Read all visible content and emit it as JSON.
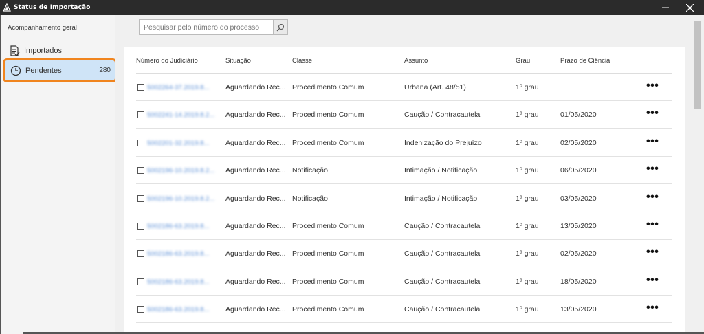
{
  "window": {
    "title": "Status de Importação"
  },
  "sidebar": {
    "overview_label": "Acompanhamento geral",
    "items": [
      {
        "label": "Importados",
        "icon": "document-list-icon"
      },
      {
        "label": "Pendentes",
        "icon": "clock-icon",
        "count": "280",
        "selected": true
      }
    ]
  },
  "search": {
    "placeholder": "Pesquisar pelo número do processo",
    "icon": "search-icon"
  },
  "table": {
    "columns": [
      "Número do Judiciário",
      "Situação",
      "Classe",
      "Assunto",
      "Grau",
      "Prazo de Ciência"
    ],
    "rows": [
      {
        "numero": "5002264-37.2019.8...",
        "situacao": "Aguardando Rec...",
        "classe": "Procedimento Comum",
        "assunto": "Urbana (Art. 48/51)",
        "grau": "1º grau",
        "prazo": ""
      },
      {
        "numero": "5002241-14.2019.8.2...",
        "situacao": "Aguardando Rec...",
        "classe": "Procedimento Comum",
        "assunto": "Caução / Contracautela",
        "grau": "1º grau",
        "prazo": "01/05/2020"
      },
      {
        "numero": "5002201-32.2019.8...",
        "situacao": "Aguardando Rec...",
        "classe": "Procedimento Comum",
        "assunto": "Indenização do Prejuízo",
        "grau": "1º grau",
        "prazo": "02/05/2020"
      },
      {
        "numero": "5002196-10.2019.8.2...",
        "situacao": "Aguardando Rec...",
        "classe": "Notificação",
        "assunto": "Intimação / Notificação",
        "grau": "1º grau",
        "prazo": "06/05/2020"
      },
      {
        "numero": "5002196-10.2019.8.2...",
        "situacao": "Aguardando Rec...",
        "classe": "Notificação",
        "assunto": "Intimação / Notificação",
        "grau": "1º grau",
        "prazo": "03/05/2020"
      },
      {
        "numero": "5002186-63.2019.8...",
        "situacao": "Aguardando Rec...",
        "classe": "Procedimento Comum",
        "assunto": "Caução / Contracautela",
        "grau": "1º grau",
        "prazo": "13/05/2020"
      },
      {
        "numero": "5002186-63.2019.8...",
        "situacao": "Aguardando Rec...",
        "classe": "Procedimento Comum",
        "assunto": "Caução / Contracautela",
        "grau": "1º grau",
        "prazo": "02/05/2020"
      },
      {
        "numero": "5002186-63.2019.8...",
        "situacao": "Aguardando Rec...",
        "classe": "Procedimento Comum",
        "assunto": "Caução / Contracautela",
        "grau": "1º grau",
        "prazo": "18/05/2020"
      },
      {
        "numero": "5002186-63.2019.8...",
        "situacao": "Aguardando Rec...",
        "classe": "Procedimento Comum",
        "assunto": "Caução / Contracautela",
        "grau": "1º grau",
        "prazo": "13/05/2020"
      }
    ],
    "row_action": "•••"
  },
  "colors": {
    "selected_bg": "#cfe4f7",
    "highlight_border": "#f0841e",
    "link": "#5b8fd6",
    "titlebar": "#2b2b2b"
  }
}
